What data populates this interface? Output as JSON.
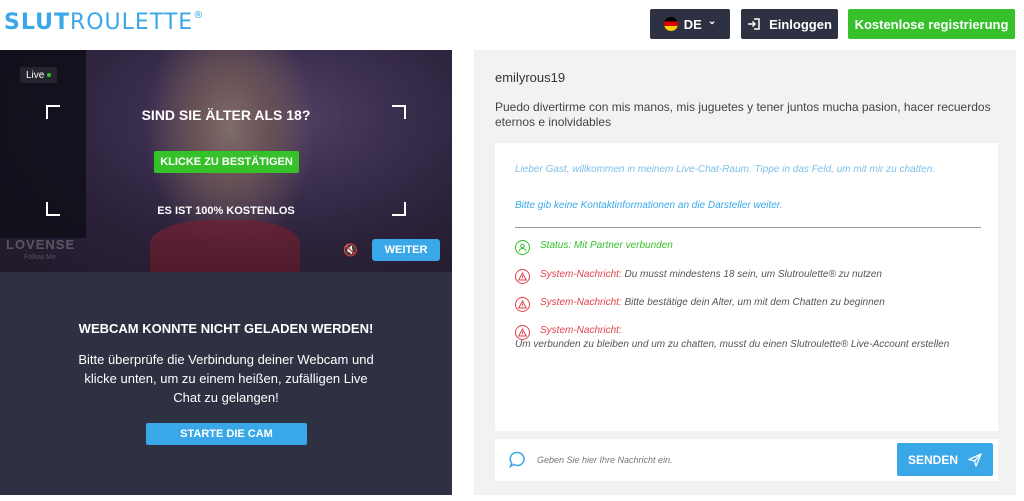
{
  "header": {
    "logo_bold": "SLUT",
    "logo_light": "ROULETTE",
    "logo_mark": "®",
    "lang_label": "DE",
    "lang_chevron": "⌄",
    "login_label": "Einloggen",
    "register_label": "Kostenlose registrierung"
  },
  "video": {
    "live_label": "Live",
    "age_question": "SIND SIE ÄLTER ALS 18?",
    "confirm_label": "KLICKE ZU BESTÄTIGEN",
    "free_label": "ES IST 100% KOSTENLOS",
    "lovense_label": "LOVENSE",
    "lovense_sub": "Follow Me",
    "mute_icon": "🔇",
    "next_label": "WEITER"
  },
  "cam": {
    "title": "WEBCAM KONNTE NICHT GELADEN WERDEN!",
    "text": "Bitte überprüfe die Verbindung deiner Webcam und klicke unten, um zu einem heißen, zufälligen Live Chat zu gelangen!",
    "start_label": "STARTE DIE CAM"
  },
  "profile": {
    "username": "emilyrous19",
    "bio": "Puedo divertirme con mis manos, mis juguetes y tener juntos mucha pasion, hacer recuerdos eternos e inolvidables"
  },
  "chat": {
    "welcome": "Lieber Gast, willkommen in meinem Live-Chat-Raum. Tippe in das Feld, um mit mir zu chatten.",
    "no_contact": "Bitte gib keine Kontaktinformationen an die Darsteller weiter.",
    "status": "Status: Mit Partner verbunden",
    "system_key": "System-Nachricht:",
    "sys1": "Du musst mindestens 18 sein, um Slutroulette® zu nutzen",
    "sys2": "Bitte bestätige dein Alter, um mit dem Chatten zu beginnen",
    "sys3": "Um verbunden zu bleiben und um zu chatten, musst du einen Slutroulette® Live-Account erstellen",
    "input_placeholder": "Geben Sie hier Ihre Nachricht ein.",
    "send_label": "SENDEN"
  },
  "colors": {
    "accent_blue": "#3aa8e8",
    "accent_green": "#36c12b",
    "dark": "#2d3142",
    "error_red": "#e0434b"
  }
}
